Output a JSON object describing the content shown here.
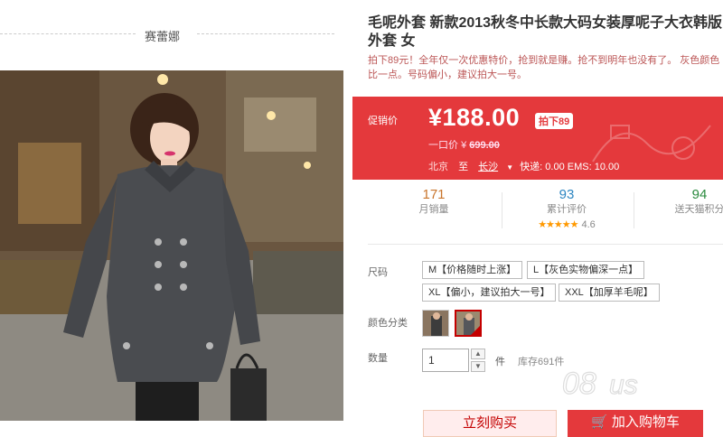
{
  "brand": {
    "name": "赛蕾娜"
  },
  "product": {
    "title": "毛呢外套 新款2013秋冬中长款大码女装厚呢子大衣韩版外套 女",
    "subtitle": "拍下89元！全年仅一次优惠特价，抢到就是赚。抢不到明年也没有了。 灰色颜色比一点。号码偏小，建议拍大一号。"
  },
  "price": {
    "label": "促销价",
    "current": "¥188.00",
    "discount_tag": "拍下89",
    "original_label": "一口价",
    "original_currency": "¥",
    "original_value": "699.00"
  },
  "shipping": {
    "from": "北京",
    "to_word": "至",
    "region": "长沙",
    "fees": "快递: 0.00 EMS: 10.00"
  },
  "stats": {
    "monthly_sales": {
      "value": "171",
      "label": "月销量"
    },
    "reviews": {
      "value": "93",
      "label": "累计评价",
      "stars": "★★★★★",
      "rating": "4.6"
    },
    "points": {
      "value": "94",
      "label": "送天猫积分"
    }
  },
  "size": {
    "label": "尺码",
    "options": [
      "M【价格随时上涨】",
      "L【灰色实物偏深一点】",
      "XL【偏小，建议拍大一号】",
      "XXL【加厚羊毛呢】"
    ]
  },
  "color": {
    "label": "颜色分类"
  },
  "quantity": {
    "label": "数量",
    "value": "1",
    "unit": "件",
    "stock": "库存691件"
  },
  "actions": {
    "buy_now": "立刻购买",
    "add_to_cart": "加入购物车"
  },
  "colors": {
    "accent": "#e4393c",
    "selected_border": "#c40000"
  }
}
